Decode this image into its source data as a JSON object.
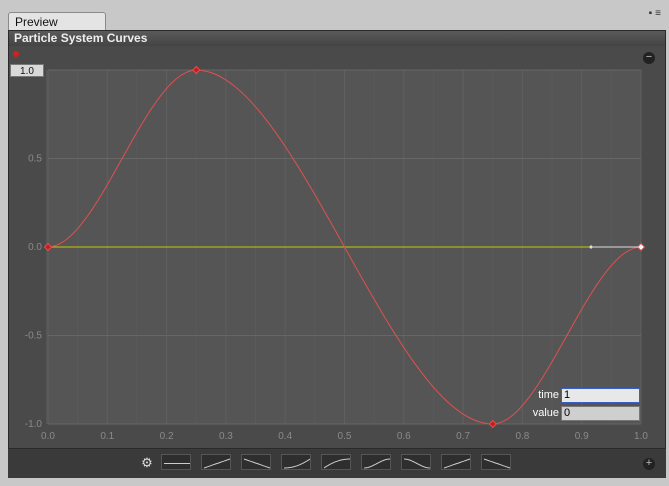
{
  "window": {
    "tab_label": "Preview"
  },
  "panel": {
    "title": "Particle System Curves",
    "ymax_value": "1.0"
  },
  "axes": {
    "x_ticks": [
      "0.0",
      "0.1",
      "0.2",
      "0.3",
      "0.4",
      "0.5",
      "0.6",
      "0.7",
      "0.8",
      "0.9",
      "1.0"
    ],
    "y_ticks": [
      "1.0",
      "0.5",
      "0.0",
      "-0.5",
      "-1.0"
    ]
  },
  "key_editor": {
    "time_label": "time",
    "time_value": "1",
    "value_label": "value",
    "value_value": "0"
  },
  "chart_data": {
    "type": "line",
    "xlim": [
      0,
      1
    ],
    "ylim": [
      -1,
      1
    ],
    "grid": true,
    "series": [
      {
        "color": "#e05050",
        "keys": [
          {
            "x": 0.0,
            "y": 0.0
          },
          {
            "x": 0.25,
            "y": 1.0
          },
          {
            "x": 0.75,
            "y": -1.0
          },
          {
            "x": 1.0,
            "y": 0.0
          }
        ]
      },
      {
        "color": "#c8c800",
        "keys": [
          {
            "x": 0.0,
            "y": 0.0
          },
          {
            "x": 1.0,
            "y": 0.0
          }
        ]
      }
    ]
  },
  "colors": {
    "accent": "#e05050",
    "secondary": "#c8c800"
  },
  "presets": [
    "flat",
    "linear-up",
    "linear-down",
    "ease-in",
    "ease-out",
    "ease-in-out-up",
    "ease-in-out-down",
    "linear-up-2",
    "linear-down-2"
  ]
}
